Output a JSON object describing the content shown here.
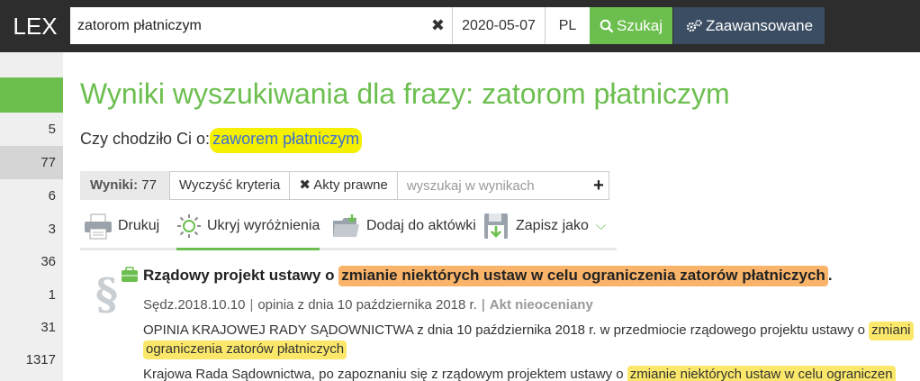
{
  "header": {
    "logo": "LEX",
    "search_value": "zatorom płatniczym",
    "clear_icon": "close-icon",
    "date": "2020-05-07",
    "lang": "PL",
    "search_button": "Szukaj",
    "advanced_button": "Zaawansowane"
  },
  "sidebar": {
    "counts": [
      "5",
      "77",
      "6",
      "3",
      "36",
      "1",
      "31",
      "1317"
    ]
  },
  "main": {
    "title": "Wyniki wyszukiwania dla frazy: zatorom płatniczym",
    "suggest_prefix": "Czy chodziło Ci o:",
    "suggest_link": "zaworem płatniczym"
  },
  "filters": {
    "results_label": "Wyniki:",
    "results_count": "77",
    "clear_criteria": "Wyczyść kryteria",
    "acts_filter": "Akty prawne",
    "search_placeholder": "wyszukaj w wynikach"
  },
  "toolbar": {
    "print": "Drukuj",
    "hide_highlights": "Ukryj wyróżnienia",
    "add_to_folder": "Dodaj do aktówki",
    "save_as": "Zapisz jako"
  },
  "result": {
    "title_prefix": "Rządowy projekt ustawy o",
    "title_highlight": "zmianie niektórych ustaw w celu ograniczenia zatorów płatniczych",
    "title_suffix": ".",
    "meta_source": "Sędz.2018.10.10",
    "meta_desc": "opinia z dnia 10 października 2018 r.",
    "meta_status": "Akt nieoceniany",
    "snippet1_text": "OPINIA KRAJOWEJ RADY SĄDOWNICTWA z dnia 10 października 2018 r. w przedmiocie rządowego projektu ustawy o",
    "snippet1_hl": "zmiani",
    "snippet1b_hl": "ograniczenia zatorów płatniczych",
    "snippet2_text": "Krajowa Rada Sądownictwa, po zapoznaniu się z rządowym projektem ustawy o",
    "snippet2_hl": "zmianie niektórych ustaw w celu ograniczen"
  },
  "colors": {
    "brand_green": "#6cbf4f",
    "topbar": "#2d2d2d",
    "advanced": "#3b4d63",
    "suggest_highlight": "#f5f000",
    "title_highlight": "#f9b46a",
    "snippet_highlight": "#fbe86a"
  }
}
